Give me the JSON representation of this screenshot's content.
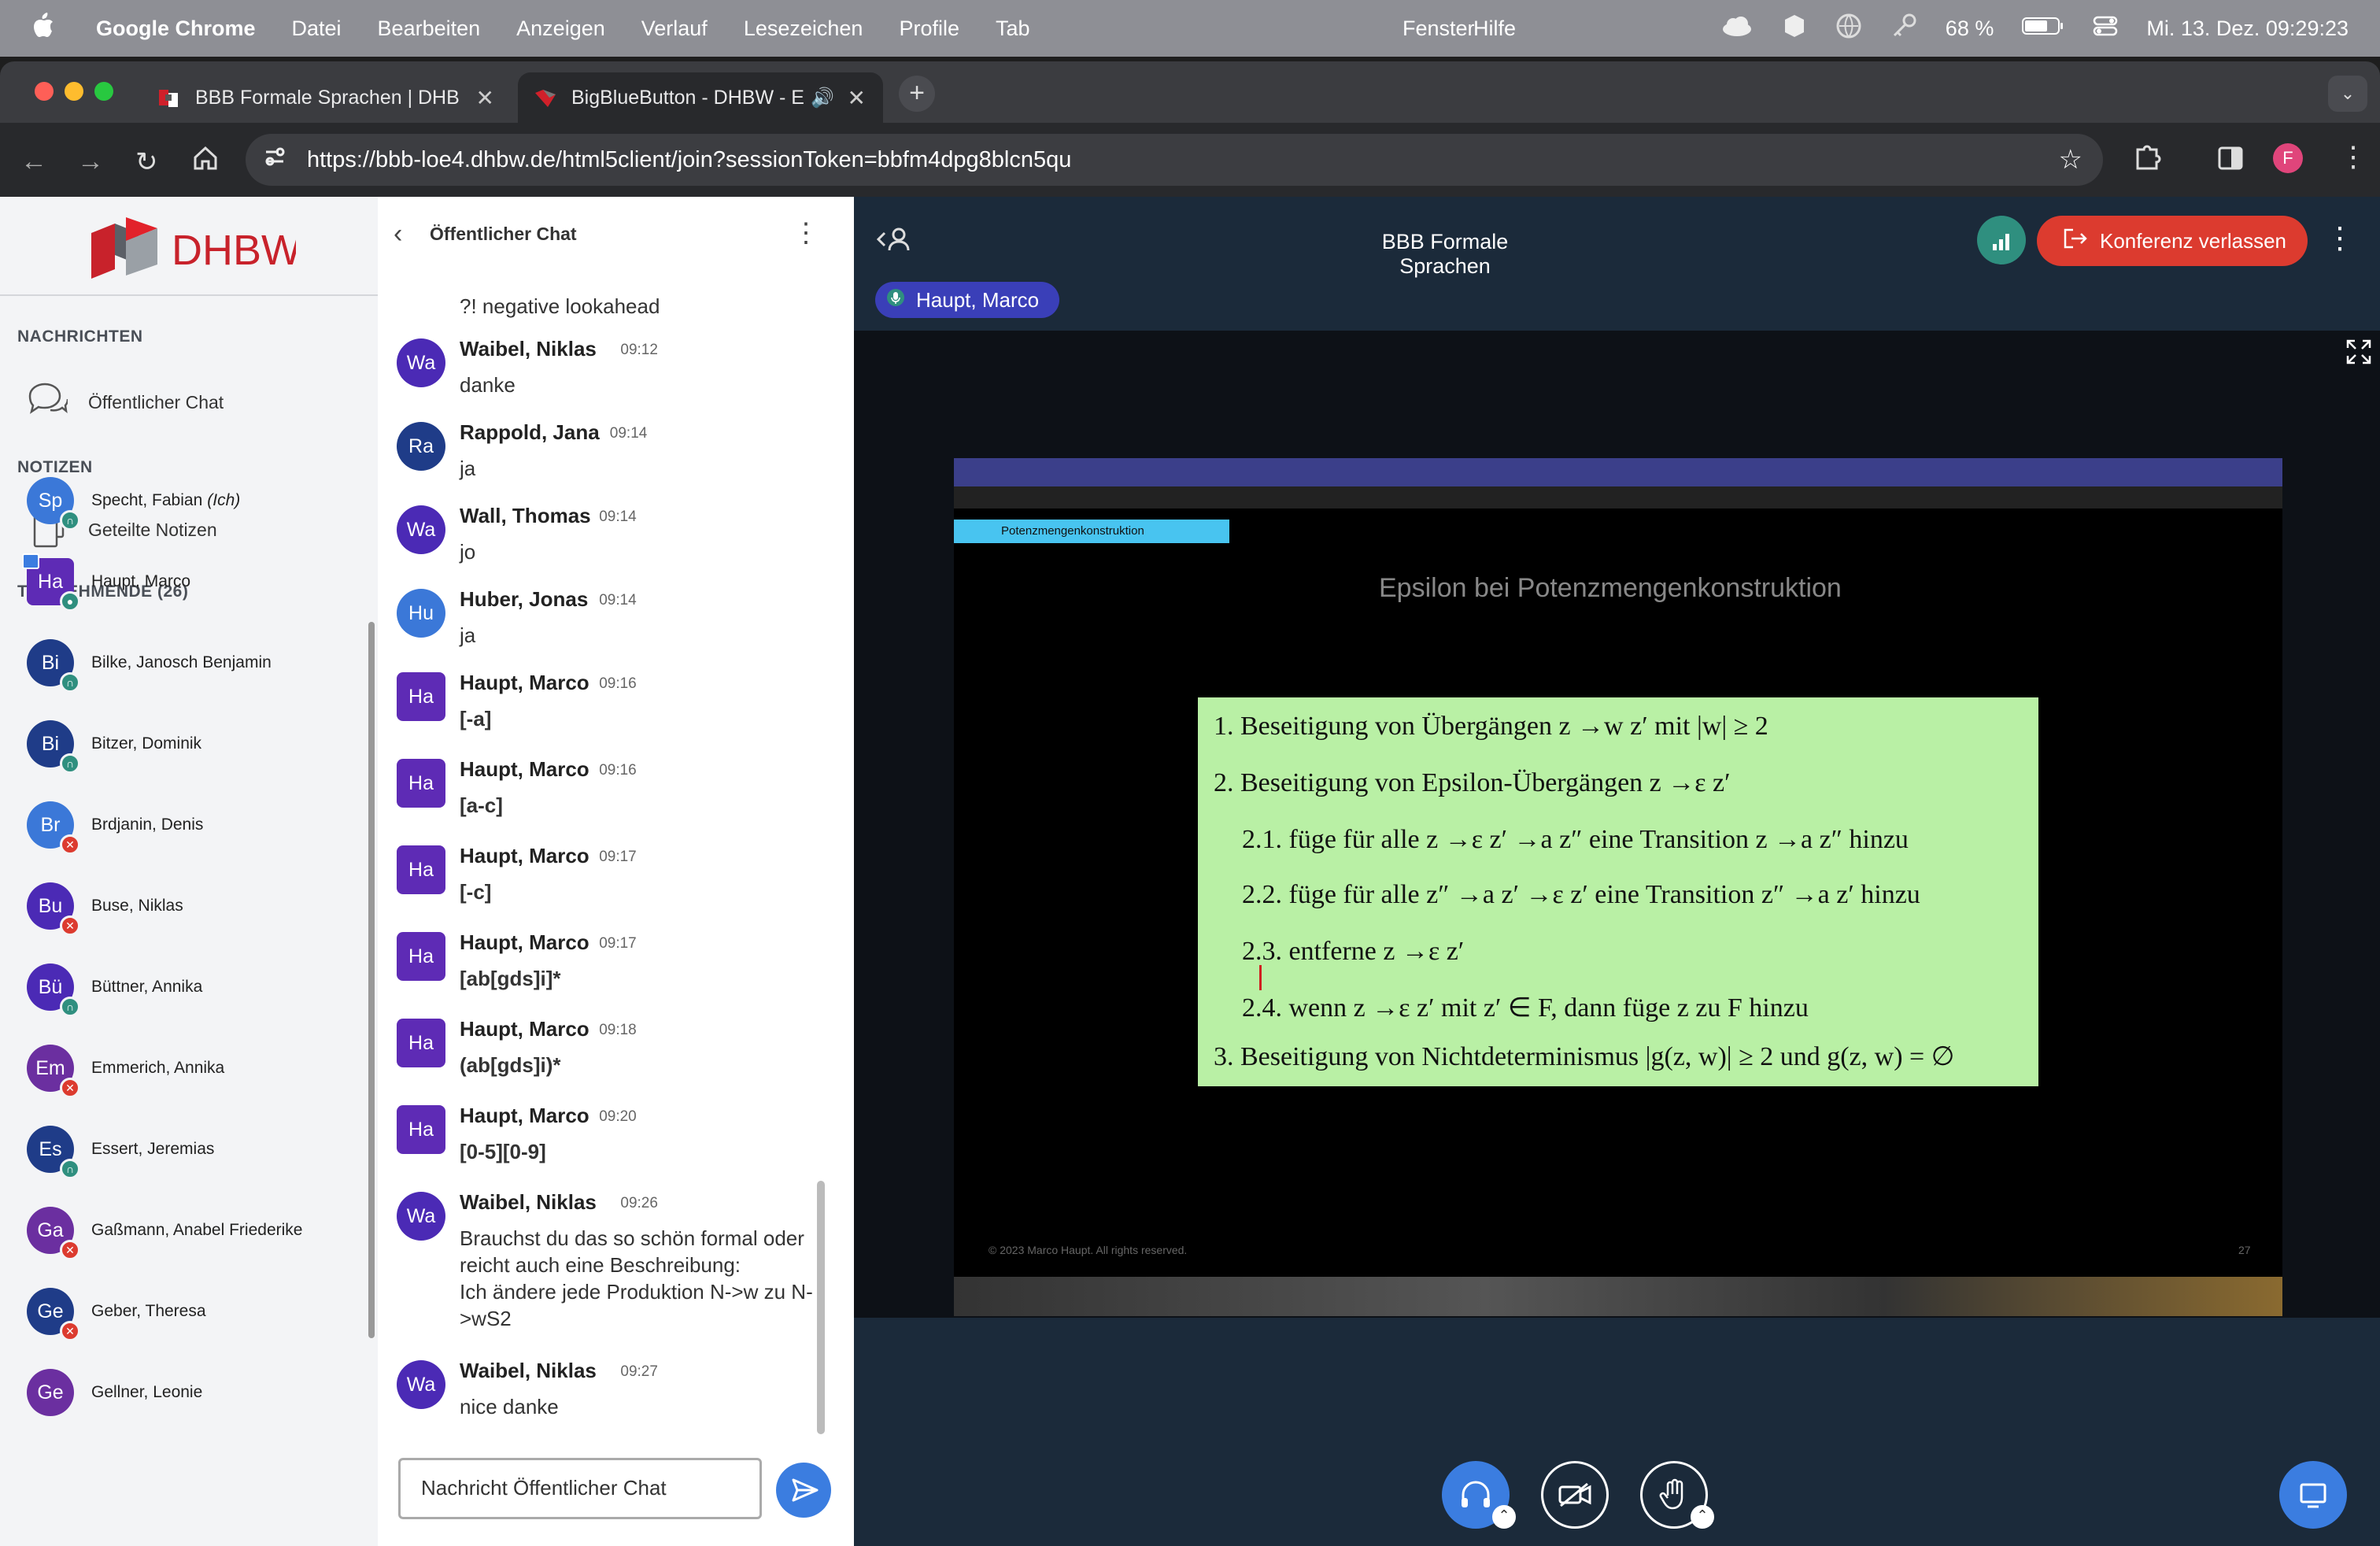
{
  "menubar": {
    "apple": "",
    "app": "Google Chrome",
    "items": [
      "Datei",
      "Bearbeiten",
      "Anzeigen",
      "Verlauf",
      "Lesezeichen",
      "Profile",
      "Tab",
      "Fenster",
      "Hilfe"
    ],
    "battery": "68 %",
    "datetime": "Mi. 13. Dez.  09:29:23"
  },
  "browser": {
    "tabs": [
      {
        "title": "BBB Formale Sprachen | DHB",
        "active": false
      },
      {
        "title": "BigBlueButton - DHBW - E",
        "active": true
      }
    ],
    "url": "https://bbb-loe4.dhbw.de/html5client/join?sessionToken=bbfm4dpg8blcn5qu",
    "profile_initial": "F"
  },
  "sidebar": {
    "logo_text": "DHBW",
    "messages_header": "NACHRICHTEN",
    "public_chat": "Öffentlicher Chat",
    "notes_header": "NOTIZEN",
    "shared_notes": "Geteilte Notizen",
    "participants_header": "TEILNEHMENDE (26)",
    "participants": [
      {
        "initials": "Sp",
        "name": "Specht, Fabian",
        "suffix": "(Ich)",
        "color": "#3b78d8",
        "badge": "listen"
      },
      {
        "initials": "Ha",
        "name": "Haupt, Marco",
        "suffix": "",
        "color": "#5e2bb5",
        "badge": "mic",
        "presenter": true
      },
      {
        "initials": "Bi",
        "name": "Bilke, Janosch Benjamin",
        "suffix": "",
        "color": "#1f3c88",
        "badge": "listen"
      },
      {
        "initials": "Bi",
        "name": "Bitzer, Dominik",
        "suffix": "",
        "color": "#1f3c88",
        "badge": "listen"
      },
      {
        "initials": "Br",
        "name": "Brdjanin, Denis",
        "suffix": "",
        "color": "#3b78d8",
        "badge": "muted"
      },
      {
        "initials": "Bu",
        "name": "Buse, Niklas",
        "suffix": "",
        "color": "#4b2ab5",
        "badge": "muted"
      },
      {
        "initials": "Bü",
        "name": "Büttner, Annika",
        "suffix": "",
        "color": "#4b2ab5",
        "badge": "listen"
      },
      {
        "initials": "Em",
        "name": "Emmerich, Annika",
        "suffix": "",
        "color": "#6b2fa0",
        "badge": "muted"
      },
      {
        "initials": "Es",
        "name": "Essert, Jeremias",
        "suffix": "",
        "color": "#1f3c88",
        "badge": "listen"
      },
      {
        "initials": "Ga",
        "name": "Gaßmann, Anabel Friederike",
        "suffix": "",
        "color": "#6b2fa0",
        "badge": "muted"
      },
      {
        "initials": "Ge",
        "name": "Geber, Theresa",
        "suffix": "",
        "color": "#1f3c88",
        "badge": "muted"
      },
      {
        "initials": "Ge",
        "name": "Gellner, Leonie",
        "suffix": "",
        "color": "#6b2fa0",
        "badge": ""
      }
    ]
  },
  "chat": {
    "title": "Öffentlicher Chat",
    "partial_top": "?! negative lookahead",
    "messages": [
      {
        "initials": "Wa",
        "name": "Waibel, Niklas",
        "time": "09:12",
        "text": "danke",
        "code": false,
        "color": "#4b2ab5"
      },
      {
        "initials": "Ra",
        "name": "Rappold, Jana",
        "time": "09:14",
        "text": "ja",
        "code": false,
        "color": "#1f3c88"
      },
      {
        "initials": "Wa",
        "name": "Wall, Thomas",
        "time": "09:14",
        "text": "jo",
        "code": false,
        "color": "#4b2ab5"
      },
      {
        "initials": "Hu",
        "name": "Huber, Jonas",
        "time": "09:14",
        "text": "ja",
        "code": false,
        "color": "#3b78d8"
      },
      {
        "initials": "Ha",
        "name": "Haupt, Marco",
        "time": "09:16",
        "text": "[-a]",
        "code": true,
        "color": "#5e2bb5",
        "square": true
      },
      {
        "initials": "Ha",
        "name": "Haupt, Marco",
        "time": "09:16",
        "text": "[a-c]",
        "code": true,
        "color": "#5e2bb5",
        "square": true
      },
      {
        "initials": "Ha",
        "name": "Haupt, Marco",
        "time": "09:17",
        "text": "[-c]",
        "code": true,
        "color": "#5e2bb5",
        "square": true
      },
      {
        "initials": "Ha",
        "name": "Haupt, Marco",
        "time": "09:17",
        "text": "[ab[gds]i]*",
        "code": true,
        "color": "#5e2bb5",
        "square": true
      },
      {
        "initials": "Ha",
        "name": "Haupt, Marco",
        "time": "09:18",
        "text": "(ab[gds]i)*",
        "code": true,
        "color": "#5e2bb5",
        "square": true
      },
      {
        "initials": "Ha",
        "name": "Haupt, Marco",
        "time": "09:20",
        "text": "[0-5][0-9]",
        "code": true,
        "color": "#5e2bb5",
        "square": true
      },
      {
        "initials": "Wa",
        "name": "Waibel, Niklas",
        "time": "09:26",
        "text": "Brauchst du das so schön formal oder reicht auch eine Beschreibung:\nIch ändere jede Produktion N->w zu N->wS2",
        "code": false,
        "color": "#4b2ab5"
      },
      {
        "initials": "Wa",
        "name": "Waibel, Niklas",
        "time": "09:27",
        "text": "nice danke",
        "code": false,
        "color": "#4b2ab5"
      }
    ],
    "input_placeholder": "Nachricht Öffentlicher Chat"
  },
  "conference": {
    "title": "BBB Formale Sprachen",
    "leave_button": "Konferenz verlassen",
    "talking": "Haupt, Marco"
  },
  "slide": {
    "section_label": "Potenzmengenkonstruktion",
    "title": "Epsilon bei Potenzmengenkonstruktion",
    "lines": [
      "1. Beseitigung von Übergängen z →w z′ mit |w| ≥ 2",
      "2. Beseitigung von Epsilon-Übergängen z →ε z′",
      "2.1.  füge für alle z →ε z′ →a z″ eine Transition z →a z″ hinzu",
      "2.2.  füge für alle z″ →a z′ →ε z′ eine Transition z″ →a z′ hinzu",
      "2.3.  entferne z →ε z′",
      "2.4.  wenn z →ε z′ mit z′ ∈ F, dann füge z zu F hinzu",
      "3. Beseitigung von Nichtdeterminismus |g(z, w)| ≥ 2 und g(z, w) = ∅"
    ]
  }
}
